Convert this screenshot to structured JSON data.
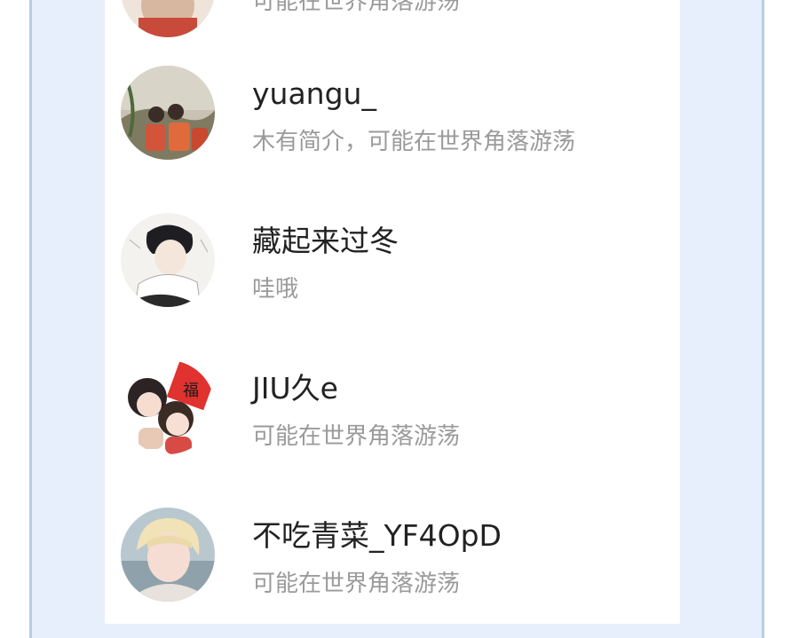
{
  "followers": [
    {
      "name": "",
      "bio": "可能在世界角落游荡"
    },
    {
      "name": "yuangu_",
      "bio": "木有简介，可能在世界角落游荡"
    },
    {
      "name": "藏起来过冬",
      "bio": "哇哦"
    },
    {
      "name": "JIU久e",
      "bio": "可能在世界角落游荡"
    },
    {
      "name": "不吃青菜_YF4OpD",
      "bio": "可能在世界角落游荡"
    }
  ],
  "avatars": [
    "avatar-icon-partial",
    "avatar-icon-outdoor-group",
    "avatar-icon-illustrated-boy",
    "avatar-icon-cartoon-chibi",
    "avatar-icon-blond-person"
  ],
  "colors": {
    "frame_bg": "#e6effb",
    "frame_border": "#b8cdea",
    "name_text": "#222222",
    "bio_text": "#9a9a9a"
  }
}
